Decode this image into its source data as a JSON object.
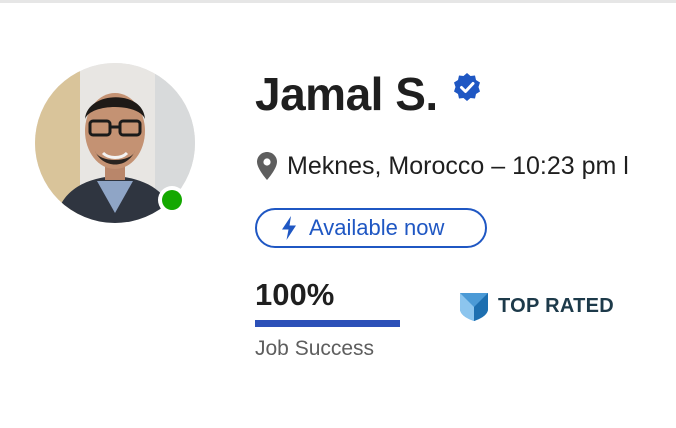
{
  "profile": {
    "name": "Jamal S.",
    "location": "Meknes, Morocco – 10:23 pm l",
    "availability": "Available now",
    "job_success": {
      "value_text": "100%",
      "percent": 100,
      "label": "Job Success"
    },
    "badge": "TOP RATED",
    "online": true
  },
  "icons": {
    "verified": "verified-check-icon",
    "location": "map-pin-icon",
    "availability": "lightning-bolt-icon",
    "badge": "top-rated-shield-icon"
  },
  "colors": {
    "accent": "#1f57c3",
    "progress": "#2c50b8",
    "online": "#14a800",
    "badge_text": "#1d3a4a"
  }
}
